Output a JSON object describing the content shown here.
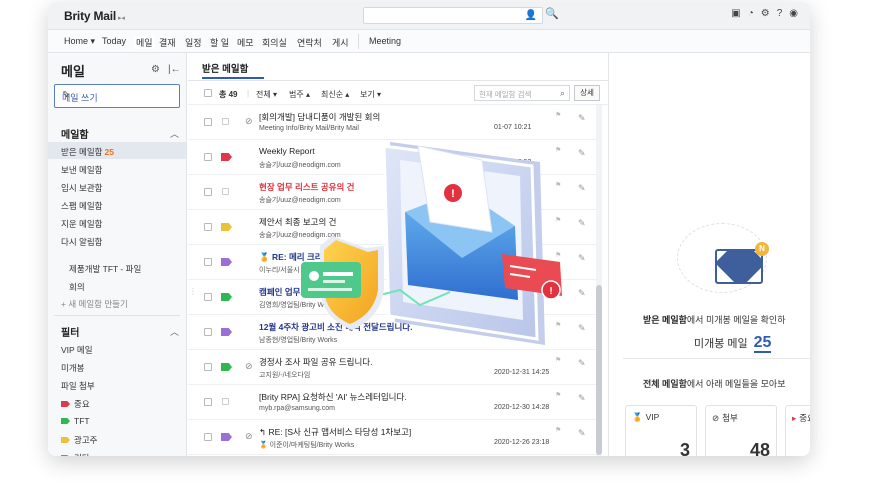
{
  "app": {
    "logo": "Brity Mail",
    "logo_sub": "▸◂"
  },
  "topbar": {
    "icons": [
      "window-icon",
      "theme-icon",
      "gear-icon",
      "help-icon",
      "user-icon"
    ]
  },
  "menubar": {
    "items": [
      "Home ▾",
      "Today",
      "메일",
      "결재",
      "일정",
      "할 일",
      "메모",
      "회의실",
      "연락처",
      "게시",
      "Meeting"
    ]
  },
  "sidebar": {
    "title": "메일",
    "compose_label": "메일 쓰기",
    "mailbox_section": "메일함",
    "mailboxes": [
      {
        "label": "받은 메일함",
        "count": "25"
      },
      {
        "label": "보낸 메일함"
      },
      {
        "label": "임시 보관함"
      },
      {
        "label": "스팸 메일함"
      },
      {
        "label": "지운 메일함"
      },
      {
        "label": "다시 알림함"
      }
    ],
    "folders": [
      "제품개발 TFT - 파일",
      "회의"
    ],
    "new_folder": "+ 새 메일함 만들기",
    "filter_section": "필터",
    "filters": [
      {
        "label": "VIP 메일"
      },
      {
        "label": "미개봉"
      },
      {
        "label": "파일 첨부"
      },
      {
        "label": "중요",
        "color": "#e0384a"
      },
      {
        "label": "TFT",
        "color": "#2fb84f"
      },
      {
        "label": "광고주",
        "color": "#e9c23a"
      },
      {
        "label": "기타",
        "color": "#9a6fd6"
      }
    ]
  },
  "main": {
    "tab": "받은 메일함",
    "toolbar": {
      "total": "총 49",
      "all": "전체 ▾",
      "category": "범주 ▴",
      "sort": "최신순 ▴",
      "view": "보기 ▾",
      "search_placeholder": "현재 메일함 검색",
      "detail": "상세"
    },
    "rows": [
      {
        "subject": "[회의개발] 담내디품이 개발된 회의",
        "sender": "Meeting Info/Brity Mail/Brity Mail",
        "date": "01-07 10:21",
        "flag": "",
        "attach": true
      },
      {
        "subject": "Weekly Report",
        "sender": "송슬기/uuz@neodigm.com",
        "date": "01-05 15:53",
        "flag": "#e0384a",
        "attach": false
      },
      {
        "subject": "현장 업무 리스트 공유의 건",
        "sender": "송슬기/uuz@neodigm.com",
        "date": "01-05 15:53",
        "flag": "",
        "attach": false,
        "style": "red"
      },
      {
        "subject": "제안서 최종 보고의 건",
        "sender": "송슬기/uuz@neodigm.com",
        "date": "01-05 15:53",
        "flag": "#e9c23a",
        "attach": false
      },
      {
        "subject": "RE: 메리 크리스마스",
        "sender": "이누리/서울시",
        "date": "",
        "flag": "#9a6fd6",
        "attach": false,
        "style": "bold-blue",
        "prefix": "🏅 "
      },
      {
        "subject": "캠페인 업무보고",
        "sender": "김영희/영업팀/Brity W",
        "date": "",
        "flag": "#2fb84f",
        "attach": false,
        "style": "bold-blue"
      },
      {
        "subject": "12월 4주차 광고비 소진 내역 전달드립니다.",
        "sender": "남종현/영업팀/Brity Works",
        "date": "",
        "flag": "#9a6fd6",
        "attach": false,
        "style": "bold-blue"
      },
      {
        "subject": "경정사 조사 파일 공유 드립니다.",
        "sender": "고지원/-/네오다임",
        "date": "2020-12-31 14:25",
        "flag": "#2fb84f",
        "attach": true
      },
      {
        "subject": "[Brity RPA] 요청하신 'AI' 뉴스레터입니다.",
        "sender": "myb.rpa@samsung.com",
        "date": "2020-12-30 14:28",
        "flag": "",
        "attach": false
      },
      {
        "subject": "RE: [S사 신규 앱서비스 타당성 1차보고]",
        "sender": "이준이/마케팅팀/Brity Works",
        "date": "2020-12-26 23:18",
        "flag": "#9a6fd6",
        "attach": true,
        "prefix": "↰ ",
        "sender_prefix": "🏅 "
      },
      {
        "subject": "",
        "sender": "",
        "date": "",
        "flag": "",
        "attach": false
      }
    ]
  },
  "right_panel": {
    "badge": "N",
    "line1_bold": "받은 메일함",
    "line1_rest": "에서 미개봉 메일을 확인하",
    "line2_label": "미개봉 메일",
    "line2_count": "25",
    "line3_bold": "전체 메일함",
    "line3_rest": "에서 아래 메일들을 모아보",
    "cards": [
      {
        "icon": "🏅",
        "label": "VIP",
        "count": "3"
      },
      {
        "icon": "⊘",
        "label": "첨부",
        "count": "48"
      },
      {
        "icon": "▸",
        "label": "중요",
        "count": ""
      }
    ]
  },
  "colors": {
    "accent": "#2f5bb5",
    "count_orange": "#e8711f"
  }
}
